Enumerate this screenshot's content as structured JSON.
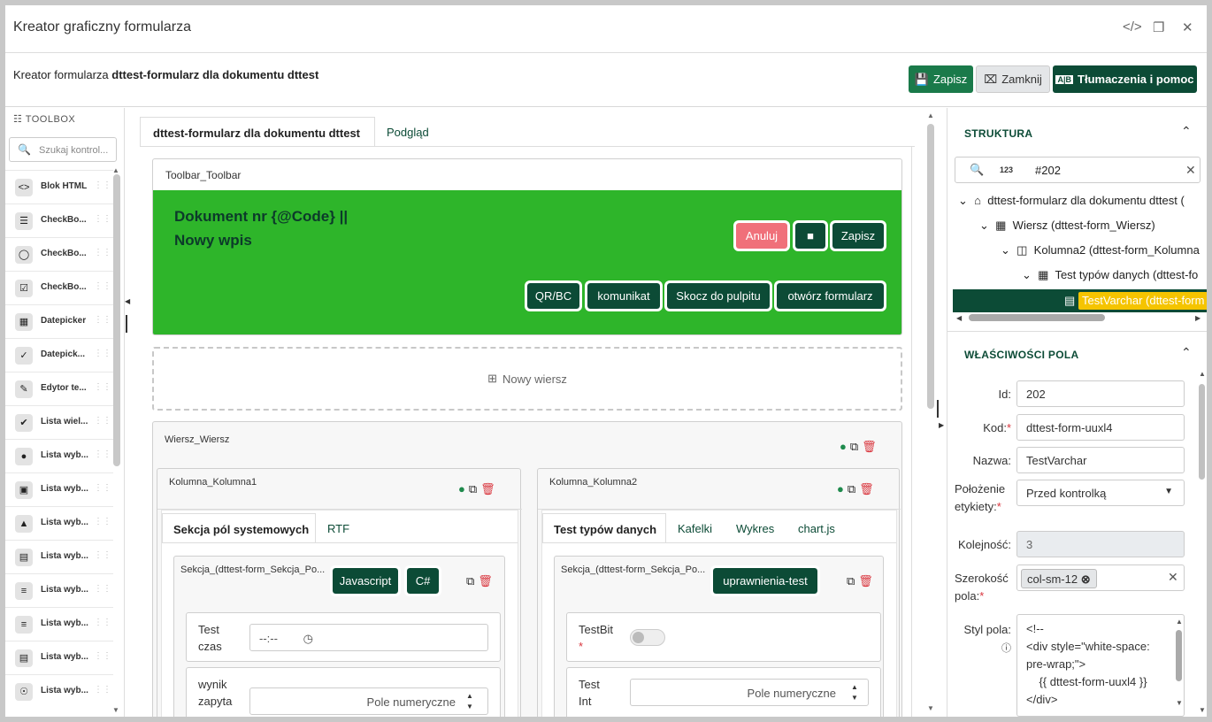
{
  "window": {
    "title": "Kreator graficzny formularza"
  },
  "header": {
    "prefix": "Kreator formularza",
    "form_name": "dttest-formularz dla dokumentu dttest",
    "save": "Zapisz",
    "close": "Zamknij",
    "translations": "Tłumaczenia i pomoc"
  },
  "toolbox": {
    "title": "TOOLBOX",
    "search_placeholder": "Szukaj kontrol...",
    "items": [
      {
        "label": "Blok HTML",
        "icon": "html-icon"
      },
      {
        "label": "CheckBo...",
        "icon": "checklist-icon"
      },
      {
        "label": "CheckBo...",
        "icon": "toggle-icon"
      },
      {
        "label": "CheckBo...",
        "icon": "checkbox-icon"
      },
      {
        "label": "Datepicker",
        "icon": "calendar-icon"
      },
      {
        "label": "Datepick...",
        "icon": "calendar-check-icon"
      },
      {
        "label": "Edytor te...",
        "icon": "edit-icon"
      },
      {
        "label": "Lista wiel...",
        "icon": "multi-check-icon"
      },
      {
        "label": "Lista wyb...",
        "icon": "user-icon"
      },
      {
        "label": "Lista wyb...",
        "icon": "book-icon"
      },
      {
        "label": "Lista wyb...",
        "icon": "sitemap-icon"
      },
      {
        "label": "Lista wyb...",
        "icon": "note-icon"
      },
      {
        "label": "Lista wyb...",
        "icon": "list-icon"
      },
      {
        "label": "Lista wyb...",
        "icon": "list-icon"
      },
      {
        "label": "Lista wyb...",
        "icon": "table-list-icon"
      },
      {
        "label": "Lista wyb...",
        "icon": "globe-icon"
      }
    ]
  },
  "editor": {
    "tabs": [
      "dttest-formularz dla dokumentu dttest",
      "Podgląd"
    ],
    "toolbar_card": {
      "title": "Toolbar_Toolbar",
      "heading": "Dokument nr {@Code} ||",
      "subheading": "Nowy wpis",
      "buttons_row1": [
        "Anuluj",
        "",
        "Zapisz"
      ],
      "buttons_row2": [
        "QR/BC",
        "komunikat",
        "Skocz do pulpitu",
        "otwórz formularz"
      ],
      "accent": "#2eb52a"
    },
    "new_row": "Nowy wiersz",
    "row_title": "Wiersz_Wiersz",
    "col1": {
      "title": "Kolumna_Kolumna1",
      "tabs": [
        "Sekcja pól systemowych",
        "RTF"
      ],
      "section": "Sekcja_(dttest-form_Sekcja_Po...",
      "section_buttons": [
        "Javascript",
        "C#"
      ],
      "fields": [
        {
          "label": "Test czas",
          "value": "--:--"
        },
        {
          "label": "wynik zapyta",
          "placeholder": "Pole numeryczne"
        }
      ]
    },
    "col2": {
      "title": "Kolumna_Kolumna2",
      "tabs": [
        "Test typów danych",
        "Kafelki",
        "Wykres",
        "chart.js"
      ],
      "section": "Sekcja_(dttest-form_Sekcja_Po...",
      "section_buttons": [
        "uprawnienia-test"
      ],
      "fields": [
        {
          "label": "TestBit"
        },
        {
          "label": "Test Int",
          "placeholder": "Pole numeryczne"
        }
      ]
    }
  },
  "structure": {
    "title": "STRUKTURA",
    "search_value": "#202",
    "num_badge": "123",
    "tree": [
      "dttest-formularz dla dokumentu dttest (",
      "Wiersz (dttest-form_Wiersz)",
      "Kolumna2 (dttest-form_Kolumna",
      "Test typów danych (dttest-fo",
      "TestVarchar (dttest-form"
    ]
  },
  "properties": {
    "title": "WŁAŚCIWOŚCI POLA",
    "id_label": "Id:",
    "id": "202",
    "code_label": "Kod:",
    "code": "dttest-form-uuxl4",
    "name_label": "Nazwa:",
    "name": "TestVarchar",
    "label_pos_label": "Położenie etykiety:",
    "label_pos": "Przed kontrolką",
    "order_label": "Kolejność:",
    "order": "3",
    "width_label": "Szerokość pola:",
    "width_tag": "col-sm-12",
    "style_label": "Styl pola:",
    "style_lines": [
      "<!--",
      "<div style=\"white-space:",
      "pre-wrap;\">",
      "    {{ dttest-form-uuxl4 }}",
      "</div>"
    ]
  },
  "colors": {
    "primary": "#0c4b36",
    "save": "#1a7a4a",
    "highlight": "#f5c400",
    "danger": "#d9363e"
  }
}
